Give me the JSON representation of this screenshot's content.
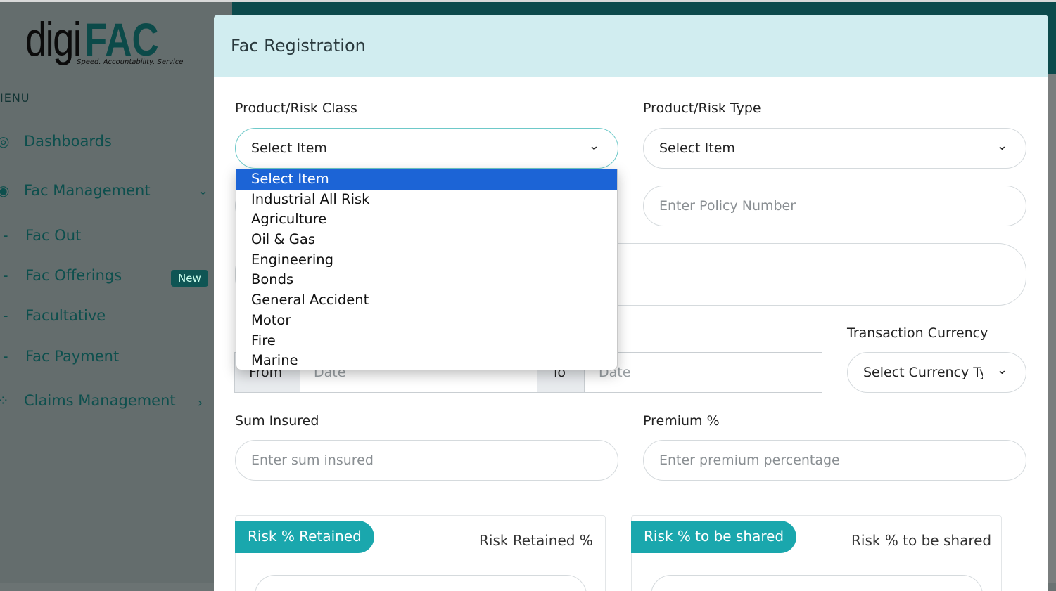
{
  "logo": {
    "text_light": "digi",
    "text_bold": "FAC",
    "tagline": "Speed. Accountability. Service"
  },
  "sidebar": {
    "menu_label": "IENU",
    "items": [
      {
        "label": "Dashboards",
        "icon": "gauge-icon"
      },
      {
        "label": "Fac Management",
        "icon": "user-circle-icon"
      },
      {
        "label": "Fac Out"
      },
      {
        "label": "Fac Offerings",
        "badge": "New"
      },
      {
        "label": "Facultative"
      },
      {
        "label": "Fac Payment"
      },
      {
        "label": "Claims Management",
        "icon": "grid-icon"
      }
    ]
  },
  "modal": {
    "title": "Fac Registration",
    "product_class": {
      "label": "Product/Risk Class",
      "value": "Select Item"
    },
    "product_type": {
      "label": "Product/Risk Type",
      "value": "Select Item"
    },
    "policy_number": {
      "placeholder": "Enter Policy Number"
    },
    "period": {
      "from": "From",
      "from_placeholder": "Date",
      "to": "To",
      "to_placeholder": "Date"
    },
    "currency": {
      "label": "Transaction Currency",
      "value": "Select Currency Ty"
    },
    "sum_insured": {
      "label": "Sum Insured",
      "placeholder": "Enter sum insured"
    },
    "premium": {
      "label": "Premium %",
      "placeholder": "Enter premium percentage"
    },
    "retained": {
      "pill": "Risk % Retained",
      "label": "Risk Retained %"
    },
    "shared": {
      "pill": "Risk % to be shared",
      "label": "Risk % to be shared"
    }
  },
  "dropdown": {
    "options": [
      "Select Item",
      "Industrial All Risk",
      "Agriculture",
      "Oil & Gas",
      "Engineering",
      "Bonds",
      "General Accident",
      "Motor",
      "Fire",
      "Marine"
    ],
    "selected": "Select Item"
  },
  "colors": {
    "accent": "#1aa7ad",
    "selected": "#1c64d6",
    "header": "#d1edf0",
    "brand": "#0c4a49"
  }
}
